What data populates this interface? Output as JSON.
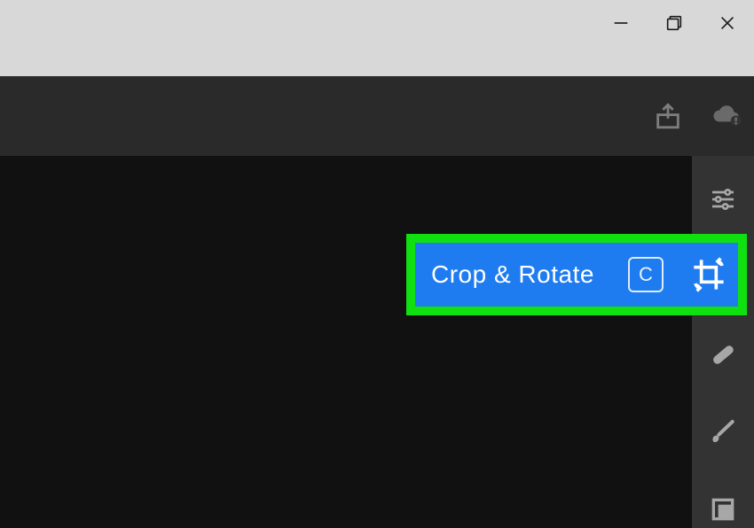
{
  "window_controls": {
    "minimize": "minimize",
    "maximize": "maximize",
    "close": "close"
  },
  "appbar": {
    "share_icon": "share",
    "cloud_icon": "cloud-status"
  },
  "sidebar": {
    "tools": [
      {
        "name": "adjust",
        "label": "Adjust"
      },
      {
        "name": "crop",
        "label": "Crop & Rotate"
      },
      {
        "name": "heal",
        "label": "Healing"
      },
      {
        "name": "brush",
        "label": "Brush"
      },
      {
        "name": "preset",
        "label": "Presets"
      }
    ]
  },
  "tooltip": {
    "label": "Crop & Rotate",
    "shortcut": "C"
  },
  "colors": {
    "highlight": "#10e010",
    "accent": "#1f7cf0",
    "titlebar": "#d8d8d8",
    "appbar": "#2a2a2a",
    "canvas": "#111111",
    "sidebar": "#333333"
  }
}
